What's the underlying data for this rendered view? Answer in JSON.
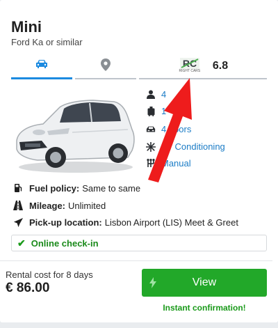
{
  "car": {
    "name": "Mini",
    "model": "Ford Ka or similar"
  },
  "tabs": {
    "car_icon": "car-icon",
    "location_icon": "location-pin-icon",
    "supplier_logo_text": "RC",
    "supplier_logo_subtext": "RIGHT CARS",
    "rating": "6.8"
  },
  "specs": {
    "seats": "4",
    "bags": "1",
    "doors": "4 doors",
    "air_conditioning": "Air Conditioning",
    "transmission": "Manual"
  },
  "details": {
    "fuel_label": "Fuel policy:",
    "fuel_value": "Same to same",
    "mileage_label": "Mileage:",
    "mileage_value": "Unlimited",
    "pickup_label": "Pick-up location:",
    "pickup_value": "Lisbon Airport (LIS) Meet & Greet"
  },
  "checkin": {
    "label": "Online check-in"
  },
  "pricing": {
    "label": "Rental cost for 8 days",
    "value": "€ 86.00"
  },
  "actions": {
    "view_label": "View",
    "instant_label": "Instant confirmation!"
  },
  "colors": {
    "accent_blue": "#1b8ae0",
    "green": "#22a829",
    "annotation_red": "#ee1c1c"
  }
}
